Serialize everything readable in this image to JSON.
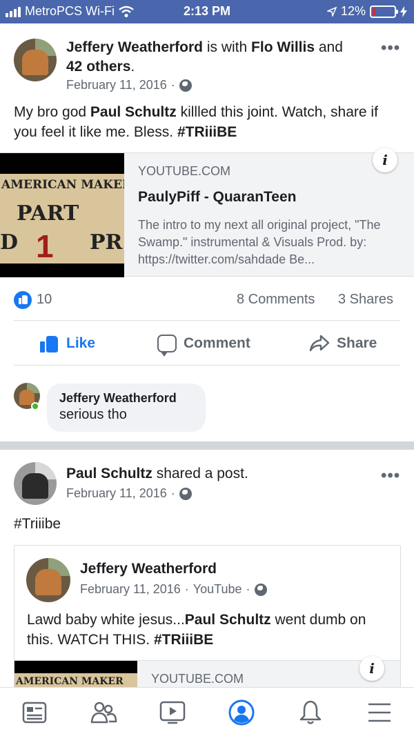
{
  "status_bar": {
    "carrier": "MetroPCS Wi-Fi",
    "time": "2:13 PM",
    "battery": "12%",
    "battery_level": 0.12,
    "battery_color": "#e0262b",
    "icons": [
      "signal-bars-icon",
      "wifi-icon",
      "location-arrow-icon",
      "battery-icon",
      "charging-bolt-icon"
    ]
  },
  "post1": {
    "author": "Jeffery Weatherford",
    "with_text": " is with ",
    "tagged": "Flo Willis",
    "and_text": " and",
    "others": "42 others",
    "others_suffix": ".",
    "date": "February 11, 2016",
    "date_sep": "·",
    "text_before": "My bro god ",
    "mention": "Paul Schultz",
    "text_mid": " killled this joint.  Watch, share if you feel it like me.  Bless.  ",
    "hashtag": "#TRiiiBE",
    "link": {
      "domain": "YOUTUBE.COM",
      "title": "PaulyPiff - QuaranTeen",
      "description": "The intro to my next all original project, \"The Swamp.\" instrumental & Visuals Prod. by: https://twitter.com/sahdade Be...",
      "thumb_line1": "AMERICAN  MAKER",
      "thumb_line2": "PART",
      "thumb_line3": "1",
      "thumb_line4": "PR",
      "thumb_line5": "D",
      "info": "i"
    },
    "reactions": "10",
    "comments": "8 Comments",
    "shares": "3 Shares",
    "actions": {
      "like": "Like",
      "comment": "Comment",
      "share": "Share"
    },
    "comment": {
      "author": "Jeffery Weatherford",
      "text": "serious tho"
    }
  },
  "post2": {
    "author": "Paul Schultz",
    "action_text": " shared a post.",
    "date": "February 11, 2016",
    "date_sep": "·",
    "text": "#Triiibe",
    "shared": {
      "author": "Jeffery Weatherford",
      "date": "February 11, 2016",
      "via": "YouTube",
      "date_sep": "·",
      "text_before": "Lawd baby white jesus...",
      "mention": "Paul Schultz",
      "text_after": " went dumb on this.  WATCH THIS.  ",
      "hashtag": "#TRiiiBE",
      "domain": "YOUTUBE.COM",
      "thumb_line1": "AMERICAN  MAKER",
      "info": "i"
    }
  },
  "bottom_nav": [
    "news-feed-icon",
    "friends-icon",
    "watch-icon",
    "profile-icon",
    "notifications-icon",
    "menu-icon"
  ],
  "colors": {
    "status_bar": "#4a67ad",
    "accent": "#1877f2",
    "secondary_text": "#606770",
    "online": "#42b72a"
  }
}
